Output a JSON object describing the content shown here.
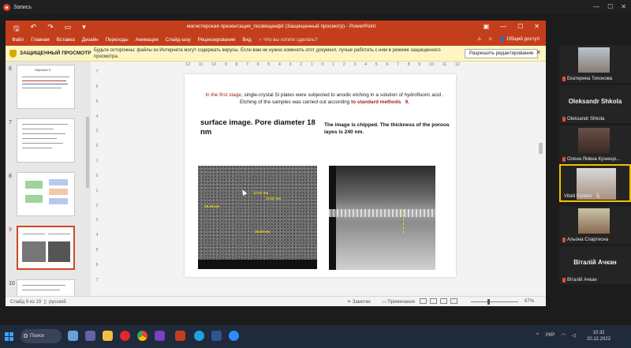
{
  "app": {
    "title": "Запись"
  },
  "powerpoint": {
    "document_title": "магистерская презентация_посвящанфії (Защищенный просмотр) - PowerPoint",
    "menu": [
      "Файл",
      "Главная",
      "Вставка",
      "Дизайн",
      "Переходы",
      "Анимация",
      "Слайд-шоу",
      "Рецензирование",
      "Вид"
    ],
    "tell_me": "Что вы хотите сделать?",
    "share": "Общий доступ",
    "protected_bar": {
      "label": "ЗАЩИЩЕННЫЙ ПРОСМОТР",
      "message": "Будьте осторожны: файлы из Интернета могут содержать вирусы. Если вам не нужно изменять этот документ, лучше работать с ним в режиме защищенного просмотра.",
      "button": "Разрешить редактирование"
    },
    "ruler_h": [
      "12",
      "11",
      "10",
      "9",
      "8",
      "7",
      "6",
      "5",
      "4",
      "3",
      "2",
      "1",
      "0",
      "1",
      "2",
      "3",
      "4",
      "5",
      "6",
      "7",
      "8",
      "9",
      "10",
      "11",
      "12"
    ],
    "ruler_v": [
      "7",
      "6",
      "5",
      "4",
      "3",
      "2",
      "1",
      "0",
      "1",
      "2",
      "3",
      "4",
      "5",
      "6",
      "7"
    ],
    "thumbnails": [
      {
        "num": "6",
        "title": "Objective 9"
      },
      {
        "num": "7"
      },
      {
        "num": "8"
      },
      {
        "num": "9",
        "selected": true
      },
      {
        "num": "10"
      }
    ],
    "slide": {
      "intro_stage": "In the first stage",
      "intro_text": ", single-crystal Si plates were subjected to anodic etching in a solution of hydrofluoric acid . Etching of the samples was carried out according ",
      "intro_link": "to standard methods",
      "intro_ref": "9.",
      "left_heading": "surface image. Pore diameter 18 nm",
      "right_heading": "The image is chipped. The thickness of the porous layes  is 240 nm.",
      "annotations": [
        "17.07 nm",
        "17.47 nm",
        "18.19 nm",
        "18.63 nm"
      ]
    },
    "status": {
      "slide_of": "Слайд 9 из 19",
      "language": "русский",
      "notes": "Заметки",
      "comments": "Примечания",
      "zoom": "67%"
    }
  },
  "participants": [
    {
      "name": "Екатерина Тихонова",
      "type": "photo"
    },
    {
      "name": "Oleksandr Shkola",
      "display": "Oleksandr Shkola",
      "type": "text"
    },
    {
      "name": "Олена Яківна Кузнецо...",
      "type": "photo"
    },
    {
      "name": "Vitalii Kidalov",
      "type": "photo",
      "speaking": true
    },
    {
      "name": "Альона Спартесна",
      "type": "photo"
    },
    {
      "name": "Віталій Ачкан",
      "display": "Віталій Ачкан",
      "type": "text"
    }
  ],
  "taskbar": {
    "search": "Поиск",
    "lang": "УКР",
    "time": "10:32",
    "date": "20.12.2022"
  },
  "colors": {
    "ppt_accent": "#c43e1c",
    "speaking": "#f2c100"
  }
}
